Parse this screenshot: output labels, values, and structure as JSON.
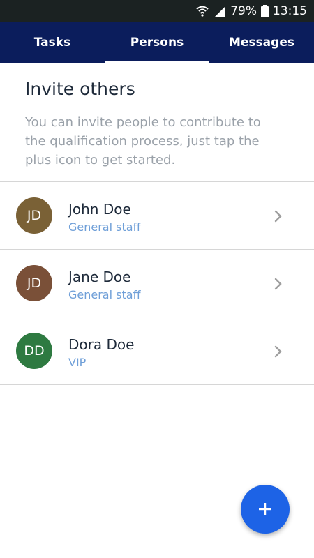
{
  "status_bar": {
    "battery_percent": "79%",
    "time": "13:15",
    "icons": [
      "wifi-icon",
      "signal-icon",
      "battery-icon"
    ]
  },
  "tabs": [
    {
      "label": "Tasks",
      "active": false
    },
    {
      "label": "Persons",
      "active": true
    },
    {
      "label": "Messages",
      "active": false
    }
  ],
  "intro": {
    "title": "Invite others",
    "description": "You can invite people to contribute to the qualification process, just tap the plus icon to get started."
  },
  "persons": [
    {
      "initials": "JD",
      "name": "John Doe",
      "role": "General staff",
      "avatar_color": "#7a6136"
    },
    {
      "initials": "JD",
      "name": "Jane Doe",
      "role": "General staff",
      "avatar_color": "#7a5038"
    },
    {
      "initials": "DD",
      "name": "Dora Doe",
      "role": "VIP",
      "avatar_color": "#2e7a41"
    }
  ],
  "fab": {
    "icon": "plus-icon",
    "color": "#1d63e6"
  },
  "colors": {
    "header": "#0b1d5c",
    "accent_text": "#6f9fd8"
  }
}
